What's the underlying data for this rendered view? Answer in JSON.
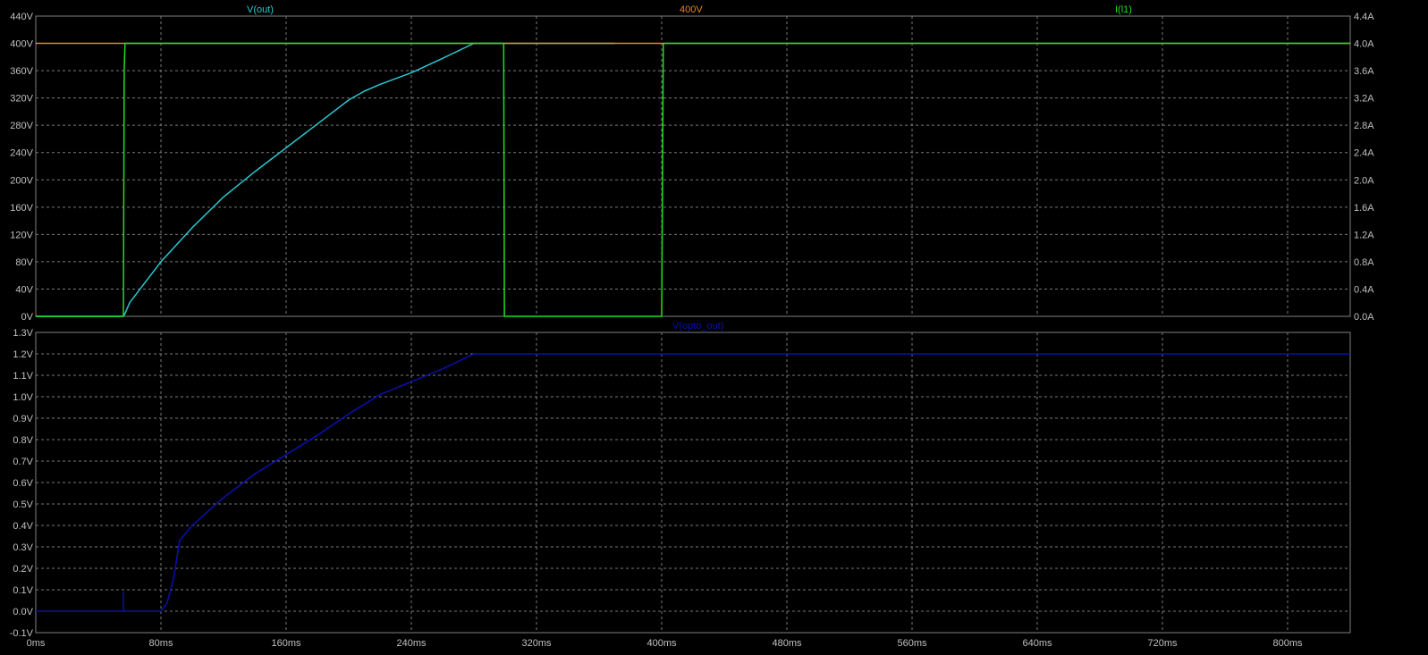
{
  "colors": {
    "background": "#000000",
    "frame": "#808080",
    "grid": "#7a7a7a",
    "tick_text": "#c0c0c0",
    "v_out": "#29c7d1",
    "v_400": "#e08a1e",
    "i_l1": "#1fe01f",
    "v_opto_out": "#0a10b0"
  },
  "chart_data": [
    {
      "type": "line",
      "title": "",
      "xlabel": "",
      "ylabel": "",
      "xlim": [
        0,
        840
      ],
      "ylim": [
        0,
        440
      ],
      "y2lim": [
        0,
        4.4
      ],
      "grid": true,
      "x_ticks": [
        "0ms",
        "80ms",
        "160ms",
        "240ms",
        "320ms",
        "400ms",
        "480ms",
        "560ms",
        "640ms",
        "720ms",
        "800ms"
      ],
      "y_ticks": [
        "0V",
        "40V",
        "80V",
        "120V",
        "160V",
        "200V",
        "240V",
        "280V",
        "320V",
        "360V",
        "400V",
        "440V"
      ],
      "y2_ticks": [
        "0.0A",
        "0.4A",
        "0.8A",
        "1.2A",
        "1.6A",
        "2.0A",
        "2.4A",
        "2.8A",
        "3.2A",
        "3.6A",
        "4.0A",
        "4.4A"
      ],
      "series": [
        {
          "name": "V(out)",
          "axis": "left",
          "x": [
            0,
            56,
            57,
            60,
            70,
            80,
            100,
            120,
            140,
            160,
            180,
            200,
            210,
            220,
            240,
            260,
            280,
            300,
            320,
            340,
            370
          ],
          "y": [
            0,
            0,
            4,
            20,
            50,
            80,
            130,
            175,
            212,
            247,
            282,
            317,
            330,
            340,
            357,
            378,
            400,
            400,
            400,
            400,
            400
          ]
        },
        {
          "name": "400V",
          "axis": "left",
          "x": [
            0,
            840
          ],
          "y": [
            400,
            400
          ]
        },
        {
          "name": "I(l1)",
          "axis": "right",
          "x": [
            0,
            56,
            56.5,
            57,
            299,
            299.5,
            400,
            400.5,
            401,
            840
          ],
          "y": [
            0,
            0,
            3.6,
            4.0,
            4.0,
            0,
            0,
            2.0,
            4.0,
            4.0
          ]
        }
      ]
    },
    {
      "type": "line",
      "title": "",
      "xlabel": "",
      "ylabel": "",
      "xlim": [
        0,
        840
      ],
      "ylim": [
        -0.1,
        1.3
      ],
      "grid": true,
      "x_ticks": [
        "0ms",
        "80ms",
        "160ms",
        "240ms",
        "320ms",
        "400ms",
        "480ms",
        "560ms",
        "640ms",
        "720ms",
        "800ms"
      ],
      "y_ticks": [
        "-0.1V",
        "0.0V",
        "0.1V",
        "0.2V",
        "0.3V",
        "0.4V",
        "0.5V",
        "0.6V",
        "0.7V",
        "0.8V",
        "0.9V",
        "1.0V",
        "1.1V",
        "1.2V",
        "1.3V"
      ],
      "series": [
        {
          "name": "V(opto_out)",
          "axis": "left",
          "x": [
            0,
            56,
            56,
            56,
            80,
            84,
            88,
            92,
            100,
            120,
            140,
            160,
            180,
            200,
            220,
            240,
            260,
            280,
            320,
            400,
            840
          ],
          "y": [
            0,
            0,
            0.09,
            0,
            0,
            0.04,
            0.15,
            0.33,
            0.4,
            0.53,
            0.64,
            0.73,
            0.82,
            0.92,
            1.01,
            1.07,
            1.13,
            1.2,
            1.2,
            1.2,
            1.2
          ]
        }
      ]
    }
  ]
}
